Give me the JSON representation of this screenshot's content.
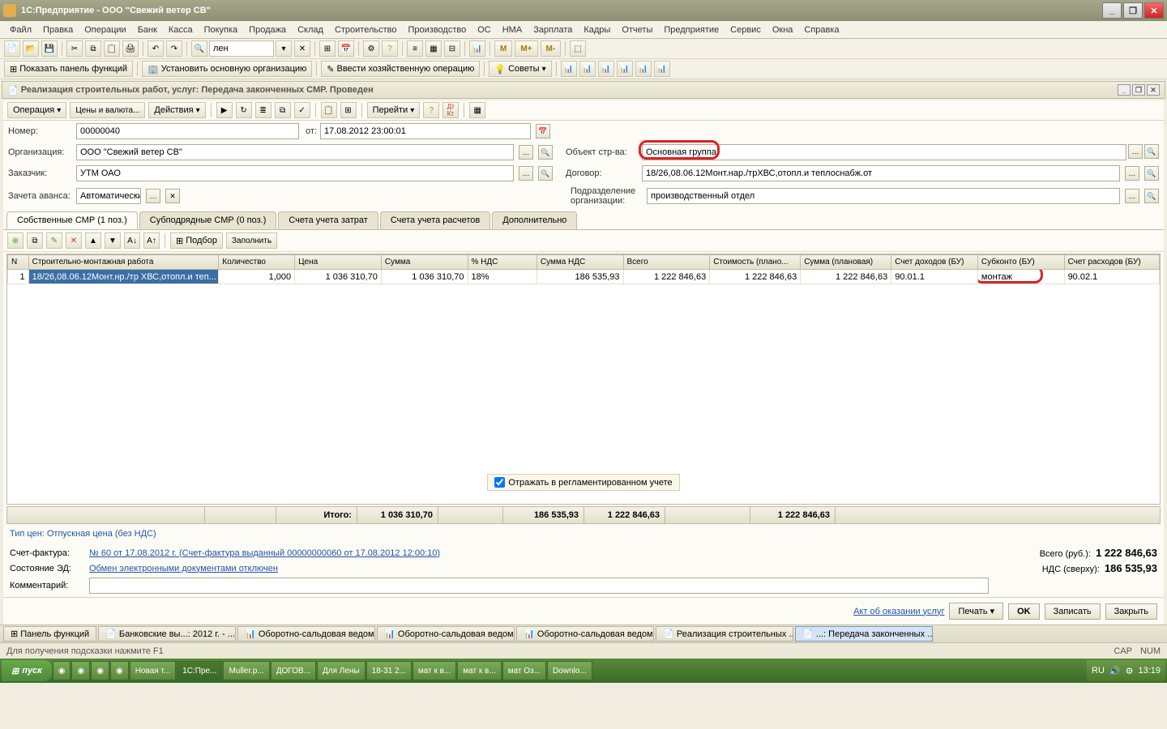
{
  "window": {
    "title": "1С:Предприятие - ООО \"Свежий ветер СВ\""
  },
  "menu": [
    "Файл",
    "Правка",
    "Операции",
    "Банк",
    "Касса",
    "Покупка",
    "Продажа",
    "Склад",
    "Строительство",
    "Производство",
    "ОС",
    "НМА",
    "Зарплата",
    "Кадры",
    "Отчеты",
    "Предприятие",
    "Сервис",
    "Окна",
    "Справка"
  ],
  "toolbar1": {
    "search": "лен",
    "m_buttons": [
      "M",
      "M+",
      "M-"
    ]
  },
  "toolbar2": {
    "b1": "Показать панель функций",
    "b2": "Установить основную организацию",
    "b3": "Ввести хозяйственную операцию",
    "b4": "Советы"
  },
  "doc": {
    "title": "Реализация строительных работ, услуг: Передача законченных СМР. Проведен",
    "toolbar": {
      "op": "Операция",
      "prices": "Цены и валюта...",
      "actions": "Действия",
      "goto": "Перейти"
    },
    "fields": {
      "number_lbl": "Номер:",
      "number": "00000040",
      "from_lbl": "от:",
      "date": "17.08.2012 23:00:01",
      "org_lbl": "Организация:",
      "org": "ООО \"Свежий ветер СВ\"",
      "cust_lbl": "Заказчик:",
      "cust": "УТМ ОАО",
      "advance_lbl": "Зачета аванса:",
      "advance": "Автоматически",
      "obj_lbl": "Объект стр-ва:",
      "obj": "Основная группа",
      "contract_lbl": "Договор:",
      "contract": "18/26,08.06.12Монт.нар./трХВС,отопл.и теплоснабж.от",
      "dept_lbl": "Подразделение организации:",
      "dept": "производственный отдел"
    },
    "tabs": [
      "Собственные СМР (1 поз.)",
      "Субподрядные СМР (0 поз.)",
      "Счета учета затрат",
      "Счета учета расчетов",
      "Дополнительно"
    ],
    "tab_toolbar": {
      "select": "Подбор",
      "fill": "Заполнить"
    },
    "grid": {
      "columns": [
        "N",
        "Строительно-монтажная работа",
        "Количество",
        "Цена",
        "Сумма",
        "% НДС",
        "Сумма НДС",
        "Всего",
        "Стоимость (плано...",
        "Сумма (плановая)",
        "Счет доходов (БУ)",
        "Субконто (БУ)",
        "Счет расходов (БУ)"
      ],
      "widths": [
        22,
        220,
        80,
        100,
        100,
        70,
        100,
        100,
        100,
        100,
        100,
        100,
        100
      ],
      "row": {
        "n": "1",
        "work": "18/26,08.06.12Монт.нр./тр ХВС,отопл.и теп...",
        "qty": "1,000",
        "price": "1 036 310,70",
        "sum": "1 036 310,70",
        "vat": "18%",
        "vat_sum": "186 535,93",
        "total": "1 222 846,63",
        "cost_plan": "1 222 846,63",
        "sum_plan": "1 222 846,63",
        "acc_income": "90.01.1",
        "subconto": "монтаж",
        "acc_expense": "90.02.1"
      }
    },
    "checkbox": "Отражать в регламентированном учете",
    "totals": {
      "label": "Итого:",
      "sum": "1 036 310,70",
      "vat": "186 535,93",
      "total": "1 222 846,63",
      "plan": "1 222 846,63"
    },
    "pricetype": "Тип цен: Отпускная цена (без НДС)",
    "invoice_lbl": "Счет-фактура:",
    "invoice": "№ 60 от 17.08.2012 г. (Счет-фактура выданный 00000000060 от 17.08.2012 12:00:10)",
    "ed_lbl": "Состояние ЭД:",
    "ed": "Обмен электронными документами отключен",
    "comment_lbl": "Комментарий:",
    "sum_lbl": "Всего (руб.):",
    "sum_val": "1 222 846,63",
    "vat_lbl": "НДС (сверху):",
    "vat_val": "186 535,93",
    "actions": {
      "act": "Акт об оказании услуг",
      "print": "Печать",
      "ok": "OK",
      "save": "Записать",
      "close": "Закрыть"
    }
  },
  "wintabs": [
    "Панель функций",
    "Банковские вы...: 2012 г. - ...",
    "Оборотно-сальдовая ведом...",
    "Оборотно-сальдовая ведом...",
    "Оборотно-сальдовая ведом...",
    "Реализация строительных ...",
    "...: Передача законченных ..."
  ],
  "status": {
    "hint": "Для получения подсказки нажмите F1",
    "cap": "CAP",
    "num": "NUM"
  },
  "taskbar": {
    "start": "пуск",
    "items": [
      "",
      "",
      "",
      "",
      "Новая т...",
      "1С:Пре...",
      "Muller.p...",
      "ДОГОВ...",
      "Для Лены",
      "18-31 2...",
      "мат к в...",
      "мат к в...",
      "мат Оз...",
      "Downlo..."
    ],
    "tray": {
      "lang": "RU",
      "time": "13:19"
    }
  }
}
